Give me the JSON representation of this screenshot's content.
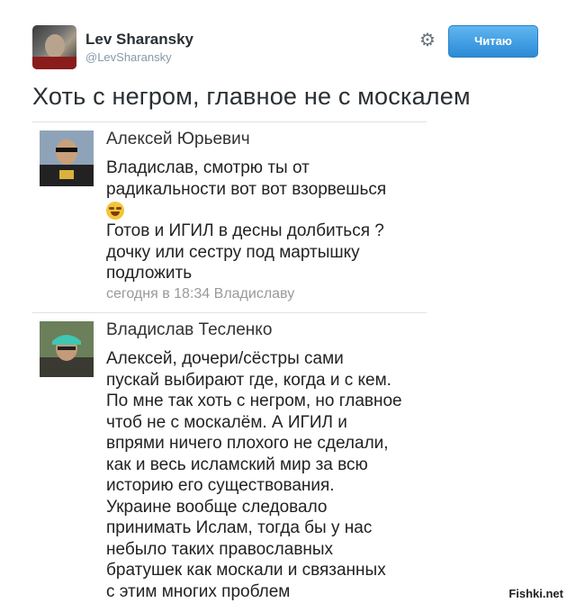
{
  "tweet_header": {
    "name": "Lev Sharansky",
    "handle": "@LevSharansky",
    "follow_label": "Читаю",
    "gear_icon": "gear-icon"
  },
  "tweet_text": "Хоть с негром, главное не с москалем",
  "comments": [
    {
      "author": "Алексей Юрьевич",
      "text_line1": "Владислав, смотрю ты от\nрадикальности вот вот взорвешься",
      "emoji": "laughing-emoji",
      "text_line2": "Готов и ИГИЛ в десны долбиться ?\nдочку или сестру под мартышку\nподложить",
      "meta": "сегодня в 18:34 Владиславу"
    },
    {
      "author": "Владислав Тесленко",
      "text": "Алексей, дочери/сёстры сами\nпускай выбирают где, когда и с кем.\nПо мне так хоть с негром, но главное\nчтоб не с москалём. А ИГИЛ и\nвпрями ничего плохого не сделали,\nкак и весь исламский мир за всю\nисторию его существования.\nУкраине вообще следовало\nпринимать Ислам, тогда бы у нас\nнебыло таких православных\nбратушек как москали и связанных\nс этим многих проблем"
    }
  ],
  "watermark": "Fishki.net",
  "colors": {
    "follow_button": "#2b8ad6",
    "text": "#292f33",
    "muted": "#8899a6"
  }
}
